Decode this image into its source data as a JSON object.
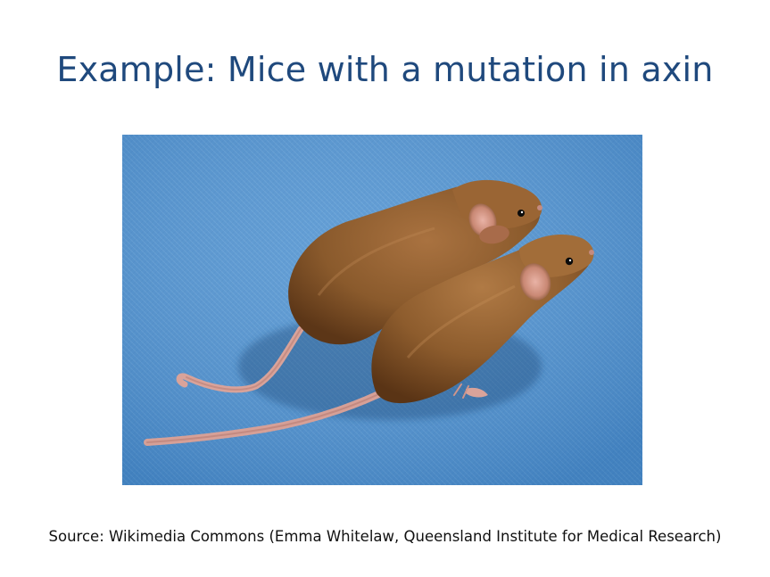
{
  "slide": {
    "title": "Example: Mice with a mutation in axin",
    "source": "Source: Wikimedia Commons (Emma Whitelaw, Queensland Institute for Medical Research)"
  },
  "photo": {
    "subject": "two-brown-mice-on-blue-cloth",
    "colors": {
      "background": "#4f92d0",
      "fur": "#8a5a2c",
      "tail": "#d9a39a"
    }
  }
}
